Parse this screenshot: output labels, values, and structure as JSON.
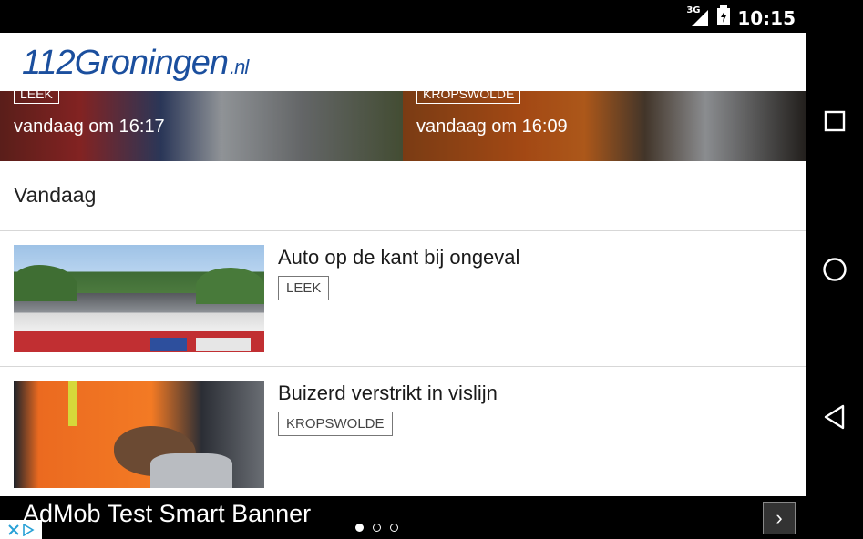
{
  "status_bar": {
    "network": "3G",
    "time": "10:15"
  },
  "app": {
    "logo_main": "112Groningen",
    "logo_suffix": ".nl"
  },
  "hero": [
    {
      "tag": "LEEK",
      "time": "vandaag om 16:17"
    },
    {
      "tag": "KROPSWOLDE",
      "time": "vandaag om 16:09"
    }
  ],
  "section": {
    "title": "Vandaag"
  },
  "articles": [
    {
      "title": "Auto op de kant bij ongeval",
      "tag": "LEEK"
    },
    {
      "title": "Buizerd verstrikt in vislijn",
      "tag": "KROPSWOLDE"
    }
  ],
  "ad": {
    "text": "AdMob Test Smart Banner",
    "arrow": "›"
  },
  "carousel": {
    "active_index": 0,
    "count": 3
  },
  "colors": {
    "brand": "#1b4f9e",
    "ad_bg": "#000000",
    "divider": "#d7d7d7"
  },
  "icons": {
    "status": [
      "signal-3g-icon",
      "battery-icon"
    ],
    "nav": [
      "recent-apps-icon",
      "home-icon",
      "back-icon"
    ],
    "ad": [
      "adchoices-icon",
      "chevron-right-icon"
    ]
  }
}
